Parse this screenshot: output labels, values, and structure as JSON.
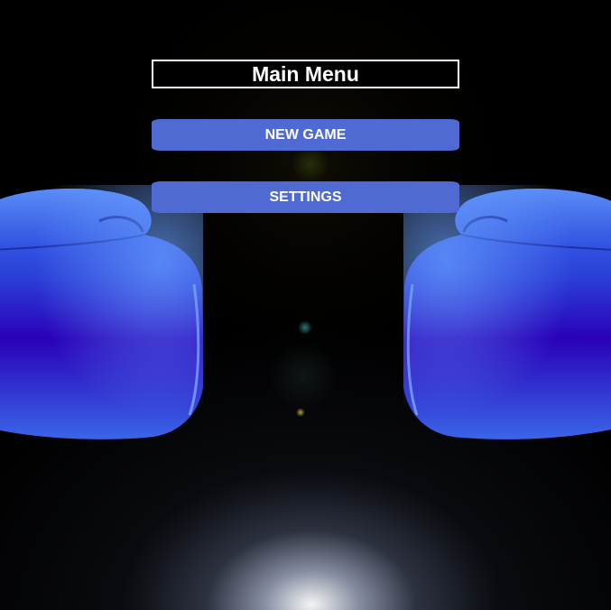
{
  "menu": {
    "title": "Main Menu",
    "buttons": [
      {
        "label": "NEW GAME"
      },
      {
        "label": "SETTINGS"
      }
    ]
  },
  "colors": {
    "background": "#000000",
    "button": "#4f6ad2",
    "button_text": "#ffffff",
    "glove": "#2f5be0"
  },
  "images": {
    "left": "boxing-glove",
    "right": "boxing-glove"
  }
}
